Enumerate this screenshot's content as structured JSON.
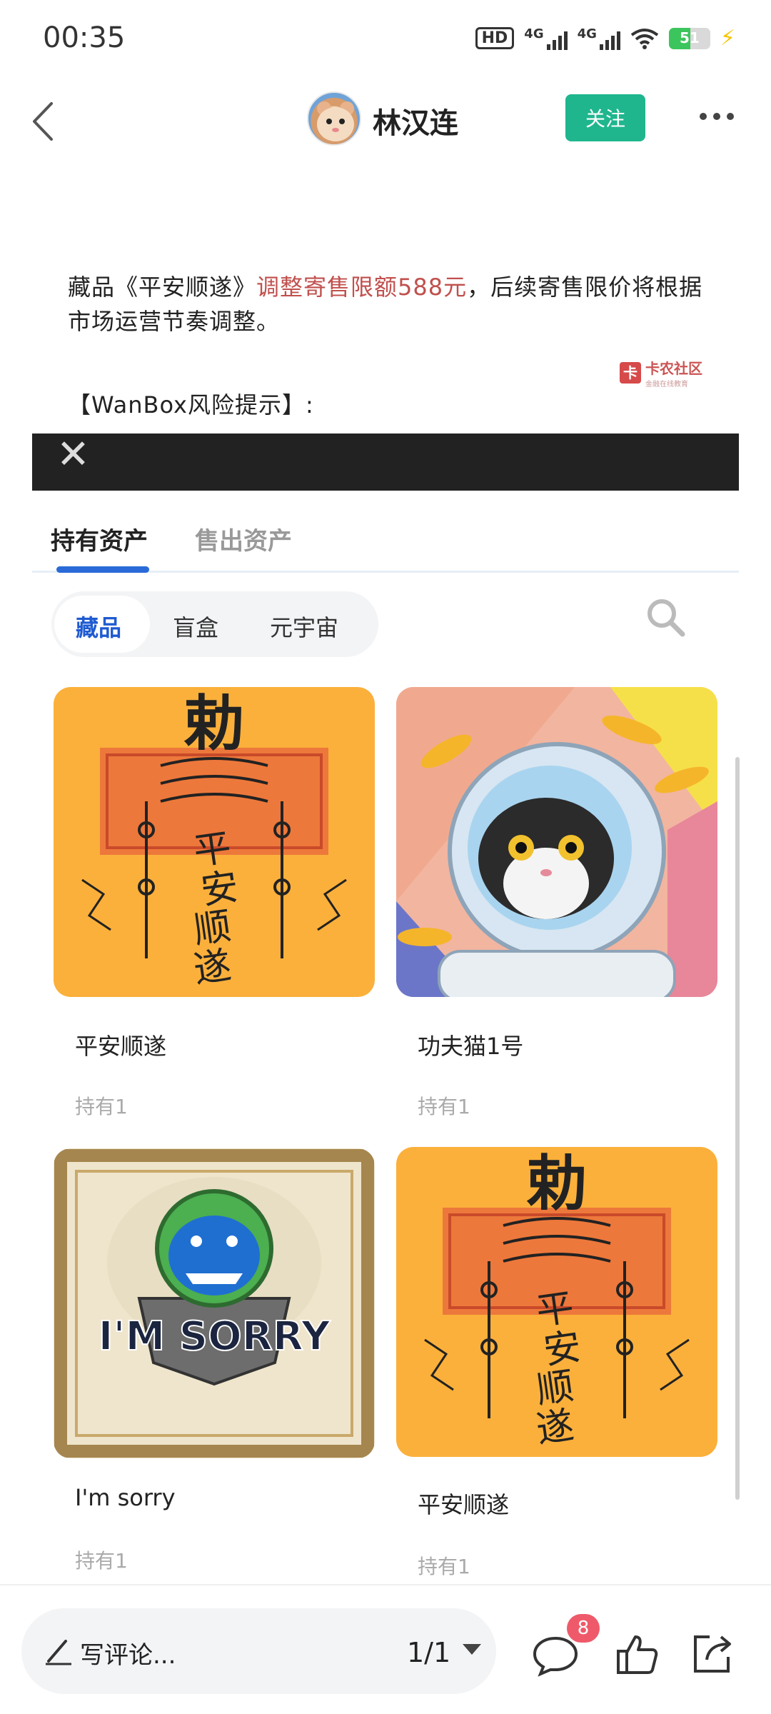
{
  "status_bar": {
    "time": "00:35",
    "hd": "HD",
    "net1": "4G",
    "net2": "4G",
    "battery": "51",
    "battery_level": 0.51
  },
  "header": {
    "author": "林汉连",
    "follow_label": "关注"
  },
  "post": {
    "line_prefix": "藏品《平安顺遂》",
    "line_highlight": "调整寄售限额588元",
    "line_suffix": "，后续寄售限价将根据市场运营节奏调整。",
    "risk_title": "【WanBox风险提示】:",
    "watermark": "卡农社区",
    "watermark_sub": "金融在线教育"
  },
  "tabs": [
    {
      "label": "持有资产",
      "active": true
    },
    {
      "label": "售出资产",
      "active": false
    }
  ],
  "filters": [
    {
      "label": "藏品",
      "active": true
    },
    {
      "label": "盲盒",
      "active": false
    },
    {
      "label": "元宇宙",
      "active": false
    }
  ],
  "items": [
    {
      "title": "平安顺遂",
      "hold": "持有1"
    },
    {
      "title": "功夫猫1号",
      "hold": "持有1"
    },
    {
      "title": "I'm sorry",
      "hold": "持有1",
      "art_text": "I'M SORRY"
    },
    {
      "title": "平安顺遂",
      "hold": "持有1"
    }
  ],
  "talisman_text": {
    "top": "勅",
    "chars": "平安顺遂"
  },
  "bottom_bar": {
    "comment_placeholder": "写评论...",
    "page": "1/1",
    "comment_count": "8"
  },
  "colors": {
    "accent_green": "#1fb68e",
    "tab_blue": "#2a6ad8",
    "highlight_red": "#c0504d",
    "badge_red": "#ef5a6a"
  }
}
